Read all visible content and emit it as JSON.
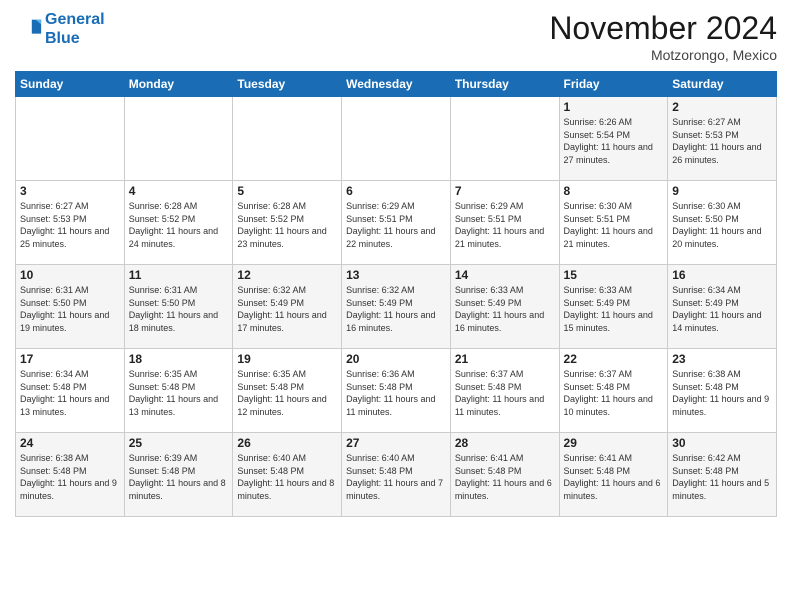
{
  "logo": {
    "line1": "General",
    "line2": "Blue"
  },
  "title": "November 2024",
  "location": "Motzorongo, Mexico",
  "days_of_week": [
    "Sunday",
    "Monday",
    "Tuesday",
    "Wednesday",
    "Thursday",
    "Friday",
    "Saturday"
  ],
  "weeks": [
    [
      {
        "day": "",
        "info": ""
      },
      {
        "day": "",
        "info": ""
      },
      {
        "day": "",
        "info": ""
      },
      {
        "day": "",
        "info": ""
      },
      {
        "day": "",
        "info": ""
      },
      {
        "day": "1",
        "info": "Sunrise: 6:26 AM\nSunset: 5:54 PM\nDaylight: 11 hours and 27 minutes."
      },
      {
        "day": "2",
        "info": "Sunrise: 6:27 AM\nSunset: 5:53 PM\nDaylight: 11 hours and 26 minutes."
      }
    ],
    [
      {
        "day": "3",
        "info": "Sunrise: 6:27 AM\nSunset: 5:53 PM\nDaylight: 11 hours and 25 minutes."
      },
      {
        "day": "4",
        "info": "Sunrise: 6:28 AM\nSunset: 5:52 PM\nDaylight: 11 hours and 24 minutes."
      },
      {
        "day": "5",
        "info": "Sunrise: 6:28 AM\nSunset: 5:52 PM\nDaylight: 11 hours and 23 minutes."
      },
      {
        "day": "6",
        "info": "Sunrise: 6:29 AM\nSunset: 5:51 PM\nDaylight: 11 hours and 22 minutes."
      },
      {
        "day": "7",
        "info": "Sunrise: 6:29 AM\nSunset: 5:51 PM\nDaylight: 11 hours and 21 minutes."
      },
      {
        "day": "8",
        "info": "Sunrise: 6:30 AM\nSunset: 5:51 PM\nDaylight: 11 hours and 21 minutes."
      },
      {
        "day": "9",
        "info": "Sunrise: 6:30 AM\nSunset: 5:50 PM\nDaylight: 11 hours and 20 minutes."
      }
    ],
    [
      {
        "day": "10",
        "info": "Sunrise: 6:31 AM\nSunset: 5:50 PM\nDaylight: 11 hours and 19 minutes."
      },
      {
        "day": "11",
        "info": "Sunrise: 6:31 AM\nSunset: 5:50 PM\nDaylight: 11 hours and 18 minutes."
      },
      {
        "day": "12",
        "info": "Sunrise: 6:32 AM\nSunset: 5:49 PM\nDaylight: 11 hours and 17 minutes."
      },
      {
        "day": "13",
        "info": "Sunrise: 6:32 AM\nSunset: 5:49 PM\nDaylight: 11 hours and 16 minutes."
      },
      {
        "day": "14",
        "info": "Sunrise: 6:33 AM\nSunset: 5:49 PM\nDaylight: 11 hours and 16 minutes."
      },
      {
        "day": "15",
        "info": "Sunrise: 6:33 AM\nSunset: 5:49 PM\nDaylight: 11 hours and 15 minutes."
      },
      {
        "day": "16",
        "info": "Sunrise: 6:34 AM\nSunset: 5:49 PM\nDaylight: 11 hours and 14 minutes."
      }
    ],
    [
      {
        "day": "17",
        "info": "Sunrise: 6:34 AM\nSunset: 5:48 PM\nDaylight: 11 hours and 13 minutes."
      },
      {
        "day": "18",
        "info": "Sunrise: 6:35 AM\nSunset: 5:48 PM\nDaylight: 11 hours and 13 minutes."
      },
      {
        "day": "19",
        "info": "Sunrise: 6:35 AM\nSunset: 5:48 PM\nDaylight: 11 hours and 12 minutes."
      },
      {
        "day": "20",
        "info": "Sunrise: 6:36 AM\nSunset: 5:48 PM\nDaylight: 11 hours and 11 minutes."
      },
      {
        "day": "21",
        "info": "Sunrise: 6:37 AM\nSunset: 5:48 PM\nDaylight: 11 hours and 11 minutes."
      },
      {
        "day": "22",
        "info": "Sunrise: 6:37 AM\nSunset: 5:48 PM\nDaylight: 11 hours and 10 minutes."
      },
      {
        "day": "23",
        "info": "Sunrise: 6:38 AM\nSunset: 5:48 PM\nDaylight: 11 hours and 9 minutes."
      }
    ],
    [
      {
        "day": "24",
        "info": "Sunrise: 6:38 AM\nSunset: 5:48 PM\nDaylight: 11 hours and 9 minutes."
      },
      {
        "day": "25",
        "info": "Sunrise: 6:39 AM\nSunset: 5:48 PM\nDaylight: 11 hours and 8 minutes."
      },
      {
        "day": "26",
        "info": "Sunrise: 6:40 AM\nSunset: 5:48 PM\nDaylight: 11 hours and 8 minutes."
      },
      {
        "day": "27",
        "info": "Sunrise: 6:40 AM\nSunset: 5:48 PM\nDaylight: 11 hours and 7 minutes."
      },
      {
        "day": "28",
        "info": "Sunrise: 6:41 AM\nSunset: 5:48 PM\nDaylight: 11 hours and 6 minutes."
      },
      {
        "day": "29",
        "info": "Sunrise: 6:41 AM\nSunset: 5:48 PM\nDaylight: 11 hours and 6 minutes."
      },
      {
        "day": "30",
        "info": "Sunrise: 6:42 AM\nSunset: 5:48 PM\nDaylight: 11 hours and 5 minutes."
      }
    ]
  ]
}
